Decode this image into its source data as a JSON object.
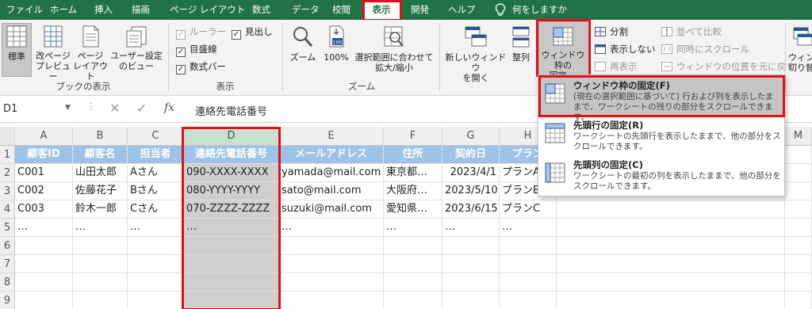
{
  "tabs": [
    {
      "label": "ファイル"
    },
    {
      "label": "ホーム"
    },
    {
      "label": "挿入"
    },
    {
      "label": "描画"
    },
    {
      "label": "ページ レイアウト"
    },
    {
      "label": "数式"
    },
    {
      "label": "データ"
    },
    {
      "label": "校閲"
    },
    {
      "label": "表示"
    },
    {
      "label": "開発"
    },
    {
      "label": "ヘルプ"
    },
    {
      "label": "何をしますか"
    }
  ],
  "active_tab": "表示",
  "ribbon": {
    "workbook_view": {
      "group_label": "ブックの表示",
      "normal": "標準",
      "page_break_preview": [
        "改ページ",
        "プレビュー"
      ],
      "page_layout": [
        "ページ",
        "レイアウト"
      ],
      "custom_views": [
        "ユーザー設定",
        "のビュー"
      ]
    },
    "show": {
      "group_label": "表示",
      "ruler": "ルーラー",
      "gridlines": "目盛線",
      "formula_bar": "数式バー",
      "headings": "見出し",
      "ruler_checked": true,
      "gridlines_checked": true,
      "formula_bar_checked": true,
      "headings_checked": true
    },
    "zoom": {
      "group_label": "ズーム",
      "zoom": "ズーム",
      "zoom100": "100%",
      "zoom_selection": [
        "選択範囲に合わせて",
        "拡大/縮小"
      ]
    },
    "window": {
      "new_window": [
        "新しいウィンドウ",
        "を開く"
      ],
      "arrange": "整列",
      "freeze_panes": [
        "ウィンドウ枠の",
        "固定"
      ],
      "split": "分割",
      "hide": "表示しない",
      "unhide": "再表示",
      "side_by_side": "並べて比較",
      "sync_scroll": "同時にスクロール",
      "reset_position": "ウィンドウの位置を元に戻す",
      "switch": [
        "ウィン",
        "切り替"
      ]
    }
  },
  "formula_bar": {
    "name_box": "D1",
    "content": "連絡先電話番号"
  },
  "columns": [
    "A",
    "B",
    "C",
    "D",
    "E",
    "F",
    "G",
    "H",
    "",
    "M"
  ],
  "rows": [
    "1",
    "2",
    "3",
    "4",
    "5",
    "6",
    "7",
    "8",
    "9"
  ],
  "table": {
    "headers": [
      "顧客ID",
      "顧客名",
      "担当者",
      "連絡先電話番号",
      "メールアドレス",
      "住所",
      "契約日",
      "プラン"
    ],
    "rows": [
      [
        "C001",
        "山田太郎",
        "Aさん",
        "090-XXXX-XXXX",
        "yamada@mail.com",
        "東京都…",
        "2023/4/1",
        "プランA"
      ],
      [
        "C002",
        "佐藤花子",
        "Bさん",
        "080-YYYY-YYYY",
        "sato@mail.com",
        "大阪府…",
        "2023/5/10",
        "プランB"
      ],
      [
        "C003",
        "鈴木一郎",
        "Cさん",
        "070-ZZZZ-ZZZZ",
        "suzuki@mail.com",
        "愛知県…",
        "2023/6/15",
        "プランC"
      ],
      [
        "…",
        "…",
        "…",
        "…",
        "…",
        "…",
        "…",
        "…"
      ]
    ]
  },
  "freeze_menu": {
    "items": [
      {
        "title": "ウィンドウ枠の固定(F)",
        "desc": "(現在の選択範囲に基づいて) 行および列を表示したままで、ワークシートの残りの部分をスクロールできます。"
      },
      {
        "title": "先頭行の固定(R)",
        "desc": "ワークシートの先頭行を表示したままで、他の部分をスクロールできます。"
      },
      {
        "title": "先頭列の固定(C)",
        "desc": "ワークシートの最初の列を表示したままで、他の部分をスクロールできます。"
      }
    ]
  },
  "colors": {
    "excel_green": "#217346",
    "header_fill": "#9dc3e6",
    "highlight_red": "#e0101a",
    "selected_column": "#cfcfcf"
  }
}
